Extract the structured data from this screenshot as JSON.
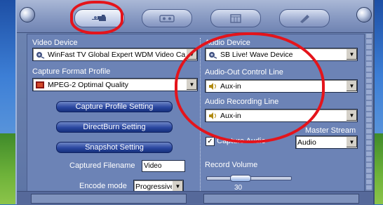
{
  "tabs": [
    {
      "name": "capture-tab",
      "icon": "hand-pointer-icon",
      "active": true
    },
    {
      "name": "playback-tab",
      "icon": "tape-icon",
      "active": false
    },
    {
      "name": "schedule-tab",
      "icon": "calendar-icon",
      "active": false
    },
    {
      "name": "settings-tab",
      "icon": "tools-icon",
      "active": false
    }
  ],
  "left": {
    "video_device_label": "Video Device",
    "video_device_value": "WinFast TV Global Expert WDM Video Ca",
    "capture_format_label": "Capture Format Profile",
    "capture_format_value": "MPEG-2 Optimal Quality",
    "btn_capture_profile": "Capture Profile Setting",
    "btn_directburn": "DirectBurn Setting",
    "btn_snapshot": "Snapshot Setting",
    "filename_label": "Captured Filename",
    "filename_value": "Video",
    "encode_label": "Encode mode",
    "encode_value": "Progressive"
  },
  "right": {
    "audio_device_label": "Audio Device",
    "audio_device_value": "SB Live! Wave Device",
    "audio_out_label": "Audio-Out Control Line",
    "audio_out_value": "Aux-in",
    "audio_rec_label": "Audio Recording Line",
    "audio_rec_value": "Aux-in",
    "capture_audio_label": "Capture Audio",
    "capture_audio_checked": true,
    "master_stream_label": "Master Stream",
    "master_stream_value": "Audio",
    "record_volume_label": "Record Volume",
    "record_volume_value": "30"
  },
  "colors": {
    "highlight_ring": "#e4141b",
    "accent": "#2a47a0"
  }
}
